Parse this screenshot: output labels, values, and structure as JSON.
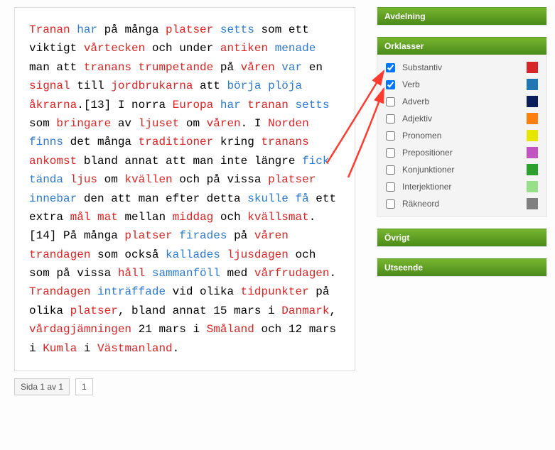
{
  "sidepanels": {
    "avdelning": "Avdelning",
    "orklasser": "Orklasser",
    "ovrigt": "Övrigt",
    "utseende": "Utseende"
  },
  "wordClasses": [
    {
      "label": "Substantiv",
      "color": "#d62728",
      "checked": true
    },
    {
      "label": "Verb",
      "color": "#1f77b4",
      "checked": true
    },
    {
      "label": "Adverb",
      "color": "#0b1e5c",
      "checked": false
    },
    {
      "label": "Adjektiv",
      "color": "#ff7f0e",
      "checked": false
    },
    {
      "label": "Pronomen",
      "color": "#e6e600",
      "checked": false
    },
    {
      "label": "Prepositioner",
      "color": "#c154c1",
      "checked": false
    },
    {
      "label": "Konjunktioner",
      "color": "#2ca02c",
      "checked": false
    },
    {
      "label": "Interjektioner",
      "color": "#98df8a",
      "checked": false
    },
    {
      "label": "Räkneord",
      "color": "#7f7f7f",
      "checked": false
    }
  ],
  "pager": {
    "text": "Sida 1 av 1",
    "page": "1"
  },
  "tokens": [
    [
      "Tranan",
      "n"
    ],
    [
      "har",
      "v"
    ],
    [
      "på",
      ""
    ],
    [
      "många",
      ""
    ],
    [
      "platser",
      "n"
    ],
    [
      "setts",
      "v"
    ],
    [
      "som",
      ""
    ],
    [
      "ett",
      ""
    ],
    [
      "viktigt",
      ""
    ],
    [
      "vårtecken",
      "n"
    ],
    [
      "och",
      ""
    ],
    [
      "under",
      ""
    ],
    [
      "antiken",
      "n"
    ],
    [
      "menade",
      "v"
    ],
    [
      "man",
      ""
    ],
    [
      "att",
      ""
    ],
    [
      "tranans",
      "n"
    ],
    [
      "trumpetande",
      "n"
    ],
    [
      "på",
      ""
    ],
    [
      "våren",
      "n"
    ],
    [
      "var",
      "v"
    ],
    [
      "en",
      ""
    ],
    [
      "signal",
      "n"
    ],
    [
      "till",
      ""
    ],
    [
      "jordbrukarna",
      "n"
    ],
    [
      "att",
      ""
    ],
    [
      "börja",
      "v"
    ],
    [
      "plöja",
      "v"
    ],
    [
      "åkrarna",
      "n"
    ],
    [
      ".[13]",
      ""
    ],
    [
      "I",
      ""
    ],
    [
      "norra",
      ""
    ],
    [
      "Europa",
      "n"
    ],
    [
      "har",
      "v"
    ],
    [
      "tranan",
      "n"
    ],
    [
      "setts",
      "v"
    ],
    [
      "som",
      ""
    ],
    [
      "bringare",
      "n"
    ],
    [
      "av",
      ""
    ],
    [
      "ljuset",
      "n"
    ],
    [
      "om",
      ""
    ],
    [
      "våren",
      "n"
    ],
    [
      ".",
      ""
    ],
    [
      "I",
      ""
    ],
    [
      "Norden",
      "n"
    ],
    [
      "finns",
      "v"
    ],
    [
      "det",
      ""
    ],
    [
      "många",
      ""
    ],
    [
      "traditioner",
      "n"
    ],
    [
      "kring",
      ""
    ],
    [
      "tranans",
      "n"
    ],
    [
      "ankomst",
      "n"
    ],
    [
      "bland",
      ""
    ],
    [
      "annat",
      ""
    ],
    [
      "att",
      ""
    ],
    [
      "man",
      ""
    ],
    [
      "inte",
      ""
    ],
    [
      "längre",
      ""
    ],
    [
      "fick",
      "v"
    ],
    [
      "tända",
      "v"
    ],
    [
      "ljus",
      "n"
    ],
    [
      "om",
      ""
    ],
    [
      "kvällen",
      "n"
    ],
    [
      "och",
      ""
    ],
    [
      "på",
      ""
    ],
    [
      "vissa",
      ""
    ],
    [
      "platser",
      "n"
    ],
    [
      "innebar",
      "v"
    ],
    [
      "den",
      ""
    ],
    [
      "att",
      ""
    ],
    [
      "man",
      ""
    ],
    [
      "efter",
      ""
    ],
    [
      "detta",
      ""
    ],
    [
      "skulle",
      "v"
    ],
    [
      "få",
      "v"
    ],
    [
      "ett",
      ""
    ],
    [
      "extra",
      ""
    ],
    [
      "mål",
      "n"
    ],
    [
      "mat",
      "n"
    ],
    [
      "mellan",
      ""
    ],
    [
      "middag",
      "n"
    ],
    [
      "och",
      ""
    ],
    [
      "kvällsmat",
      "n"
    ],
    [
      ".[14]",
      ""
    ],
    [
      "På",
      ""
    ],
    [
      "många",
      ""
    ],
    [
      "platser",
      "n"
    ],
    [
      "firades",
      "v"
    ],
    [
      "på",
      ""
    ],
    [
      "våren",
      "n"
    ],
    [
      "trandagen",
      "n"
    ],
    [
      "som",
      ""
    ],
    [
      "också",
      ""
    ],
    [
      "kallades",
      "v"
    ],
    [
      "ljusdagen",
      "n"
    ],
    [
      "och",
      ""
    ],
    [
      "som",
      ""
    ],
    [
      "på",
      ""
    ],
    [
      "vissa",
      ""
    ],
    [
      "håll",
      "n"
    ],
    [
      "sammanföll",
      "v"
    ],
    [
      "med",
      ""
    ],
    [
      "vårfrudagen",
      "n"
    ],
    [
      ".",
      ""
    ],
    [
      "Trandagen",
      "n"
    ],
    [
      "inträffade",
      "v"
    ],
    [
      "vid",
      ""
    ],
    [
      "olika",
      ""
    ],
    [
      "tidpunkter",
      "n"
    ],
    [
      "på",
      ""
    ],
    [
      "olika",
      ""
    ],
    [
      "platser",
      "n"
    ],
    [
      ",",
      ""
    ],
    [
      "bland",
      ""
    ],
    [
      "annat",
      ""
    ],
    [
      "15",
      ""
    ],
    [
      "mars",
      ""
    ],
    [
      "i",
      ""
    ],
    [
      "Danmark",
      "n"
    ],
    [
      ",",
      ""
    ],
    [
      "vårdagjämningen",
      "n"
    ],
    [
      "21",
      ""
    ],
    [
      "mars",
      ""
    ],
    [
      "i",
      ""
    ],
    [
      "Småland",
      "n"
    ],
    [
      "och",
      ""
    ],
    [
      "12",
      ""
    ],
    [
      "mars",
      ""
    ],
    [
      "i",
      ""
    ],
    [
      "Kumla",
      "n"
    ],
    [
      "i",
      ""
    ],
    [
      "Västmanland",
      "n"
    ],
    [
      ".",
      ""
    ]
  ]
}
